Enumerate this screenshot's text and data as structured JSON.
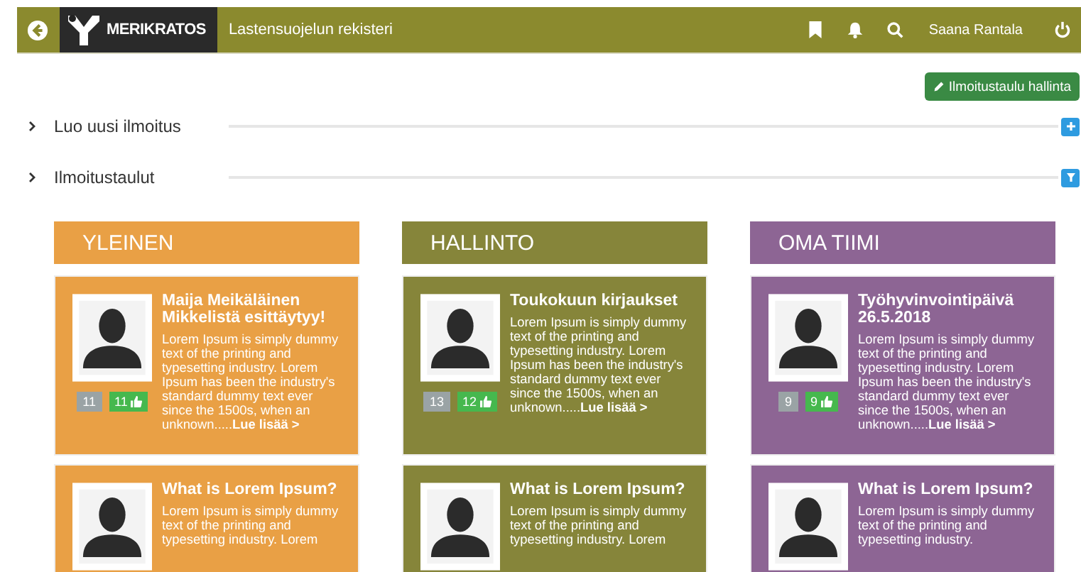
{
  "header": {
    "logo": "MERIKRATOS",
    "title": "Lastensuojelun rekisteri",
    "user": "Saana Rantala"
  },
  "manage_button": "Ilmoitustaulu hallinta",
  "sections": [
    {
      "label": "Luo uusi ilmoitus",
      "kind": "add"
    },
    {
      "label": "Ilmoitustaulut",
      "kind": "filter"
    }
  ],
  "columns": [
    {
      "title": "YLEINEN",
      "color": "#e9a045",
      "cards": [
        {
          "title": "Maija Meikäläinen Mikkelistä esittäytyy!",
          "body": "Lorem Ipsum is simply dummy text of the printing and typesetting industry. Lorem Ipsum has been the industry's standard dummy text ever since the 1500s, when an unknown.....",
          "link": "Lue lisää >",
          "count": "11",
          "likes": "11"
        },
        {
          "title": "What is Lorem Ipsum?",
          "body": "Lorem Ipsum is simply dummy text of the printing and typesetting industry. Lorem"
        }
      ]
    },
    {
      "title": "HALLINTO",
      "color": "#86853a",
      "cards": [
        {
          "title": "Toukokuun kirjaukset",
          "body": "Lorem Ipsum is simply dummy text of the printing and typesetting industry. Lorem Ipsum has been the industry's standard dummy text ever since the 1500s, when an unknown.....",
          "link": "Lue lisää >",
          "count": "13",
          "likes": "12"
        },
        {
          "title": "What is Lorem Ipsum?",
          "body": "Lorem Ipsum is simply dummy text of the printing and typesetting industry. Lorem"
        }
      ]
    },
    {
      "title": "OMA TIIMI",
      "color": "#8d6594",
      "cards": [
        {
          "title": "Työhyvinvointipäivä 26.5.2018",
          "body": "Lorem Ipsum is simply dummy text of the printing and typesetting industry. Lorem Ipsum has been the industry's standard dummy text ever since the 1500s, when an unknown.....",
          "link": "Lue lisää >",
          "count": "9",
          "likes": "9"
        },
        {
          "title": "What is Lorem Ipsum?",
          "body": "Lorem Ipsum is simply dummy text of the printing and typesetting industry."
        }
      ]
    }
  ]
}
